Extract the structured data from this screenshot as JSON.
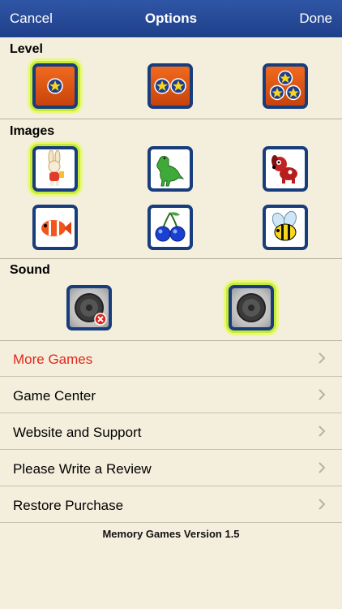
{
  "navbar": {
    "cancel_label": "Cancel",
    "title": "Options",
    "done_label": "Done"
  },
  "sections": {
    "level": "Level",
    "images": "Images",
    "sound": "Sound"
  },
  "level_options": [
    {
      "name": "one-star-level",
      "stars": 1,
      "selected": true
    },
    {
      "name": "two-star-level",
      "stars": 2,
      "selected": false
    },
    {
      "name": "three-star-level",
      "stars": 3,
      "selected": false
    }
  ],
  "image_options": [
    {
      "icon": "rabbit-icon",
      "selected": true
    },
    {
      "icon": "dinosaur-icon",
      "selected": false
    },
    {
      "icon": "dog-icon",
      "selected": false
    },
    {
      "icon": "fish-icon",
      "selected": false
    },
    {
      "icon": "cherries-icon",
      "selected": false
    },
    {
      "icon": "bee-icon",
      "selected": false
    }
  ],
  "sound_options": [
    {
      "icon": "speaker-muted-icon",
      "selected": false
    },
    {
      "icon": "speaker-on-icon",
      "selected": true
    }
  ],
  "menu": [
    {
      "label": "More Games",
      "color": "#e1281c"
    },
    {
      "label": "Game Center",
      "color": "#000000"
    },
    {
      "label": "Website and Support",
      "color": "#000000"
    },
    {
      "label": "Please Write a Review",
      "color": "#000000"
    },
    {
      "label": "Restore Purchase",
      "color": "#000000"
    }
  ],
  "footer": {
    "version_text": "Memory Games Version 1.5"
  },
  "colors": {
    "nav_bar": "#2a4f9e",
    "selected_glow": "#c6e93a",
    "tile_border": "#173d7c",
    "background": "#f4eedc"
  }
}
